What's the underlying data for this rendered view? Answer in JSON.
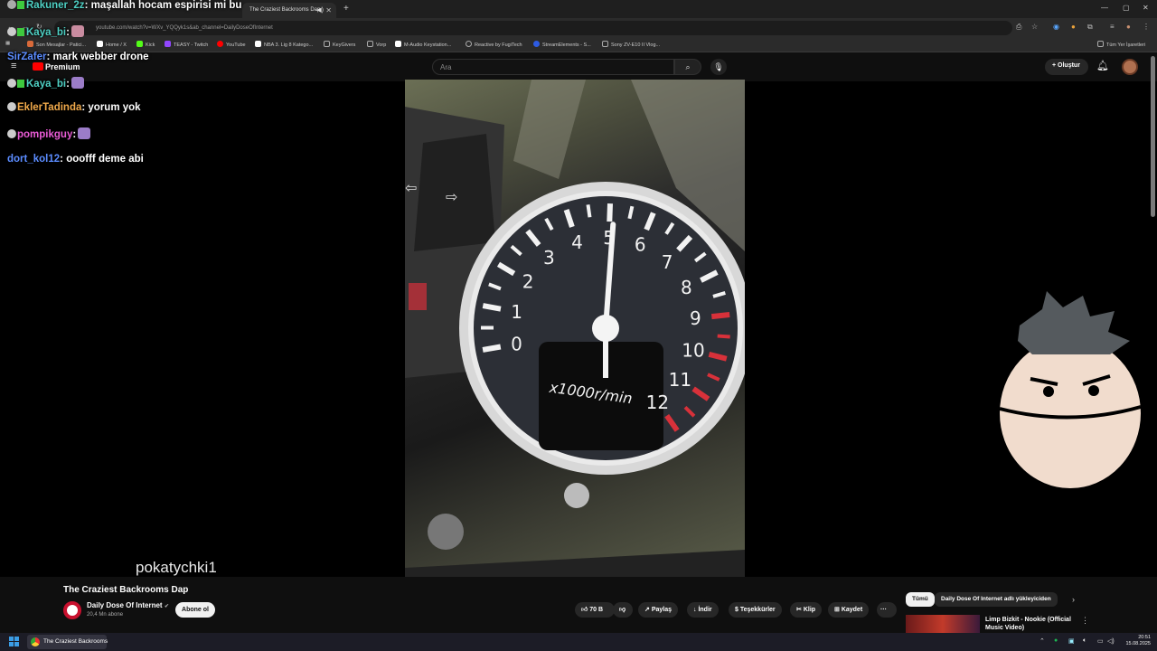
{
  "browser": {
    "tab_title": "The Craziest Backrooms Dap",
    "new_tab": "+",
    "url": "youtube.com/watch?v=WXv_YQQyk1s&ab_channel=DailyDoseOfInternet",
    "bookmarks": [
      {
        "label": "Son Mesajlar - Patici...",
        "color": "#d96a3a"
      },
      {
        "label": "Home / X",
        "color": "#ffffff"
      },
      {
        "label": "Kick",
        "color": "#53fc18"
      },
      {
        "label": "TEASY - Twitch",
        "color": "#9146ff"
      },
      {
        "label": "YouTube",
        "color": "#ff0000"
      },
      {
        "label": "NBA 3. Lig 8 Katego...",
        "color": "#ffffff"
      },
      {
        "label": "KeyGivers",
        "color": "#888888"
      },
      {
        "label": "Vorp",
        "color": "#888888"
      },
      {
        "label": "M-Audio Keystation...",
        "color": "#ffffff"
      },
      {
        "label": "Reactive by FugiTech",
        "color": "#888888"
      },
      {
        "label": "StreamElements - S...",
        "color": "#2d5be3"
      },
      {
        "label": "Sony ZV-E10 II Vlog...",
        "color": "#888888"
      }
    ],
    "all_bookmarks": "Tüm Yer İşaretleri"
  },
  "youtube": {
    "logo_text": "Premium",
    "search_placeholder": "Ara",
    "create_label": "Oluştur"
  },
  "chat": [
    {
      "user": "Rakuner_2z",
      "user_color": "#4fd1c5",
      "text": ": maşallah hocam espirisi mi bu",
      "emote": false,
      "badges": false
    },
    {
      "user": "Kaya_bi",
      "user_color": "#4fd1c5",
      "text": ":",
      "emote": true,
      "badges": true
    },
    {
      "user": "SirZafer",
      "user_color": "#5b8cff",
      "text": ": mark webber drone",
      "emote": false,
      "badges": false
    },
    {
      "user": "Kaya_bi",
      "user_color": "#4fd1c5",
      "text": ":",
      "emote": true,
      "badges": true
    },
    {
      "user": "EklerTadinda",
      "user_color": "#f0a94a",
      "text": ": yorum yok",
      "emote": false,
      "badges": false
    },
    {
      "user": "pompikguy",
      "user_color": "#e85bd4",
      "text": ":",
      "emote": true,
      "badges": false
    },
    {
      "user": "dort_kol12",
      "user_color": "#5b8cff",
      "text": ": ooofff deme abi",
      "emote": false,
      "badges": false
    }
  ],
  "video": {
    "gauge_numbers": [
      "0",
      "1",
      "2",
      "3",
      "4",
      "5",
      "6",
      "7",
      "8",
      "9",
      "10",
      "11",
      "12"
    ],
    "gauge_unit": "x1000r/min",
    "needle_rpm": 5.1
  },
  "watermark": "pokatychki1",
  "meta": {
    "title": "The Craziest Backrooms Dap",
    "channel": "Daily Dose Of Internet",
    "verified": "✔",
    "subscribers": "20,4 Mn abone",
    "subscribe": "Abone ol",
    "likes": "70 B",
    "share": "Paylaş",
    "download": "İndir",
    "thanks": "Teşekkürler",
    "clip": "Klip",
    "save": "Kaydet",
    "more": "···"
  },
  "related": {
    "chip_all": "Tümü",
    "chip_channel": "Daily Dose Of Internet adlı yükleyiciden",
    "rec_title": "Limp Bizkit - Nookie (Official Music Video)"
  },
  "taskbar": {
    "app_label": "The Craziest Backrooms",
    "time": "20:51",
    "date": "15.08.2025"
  }
}
